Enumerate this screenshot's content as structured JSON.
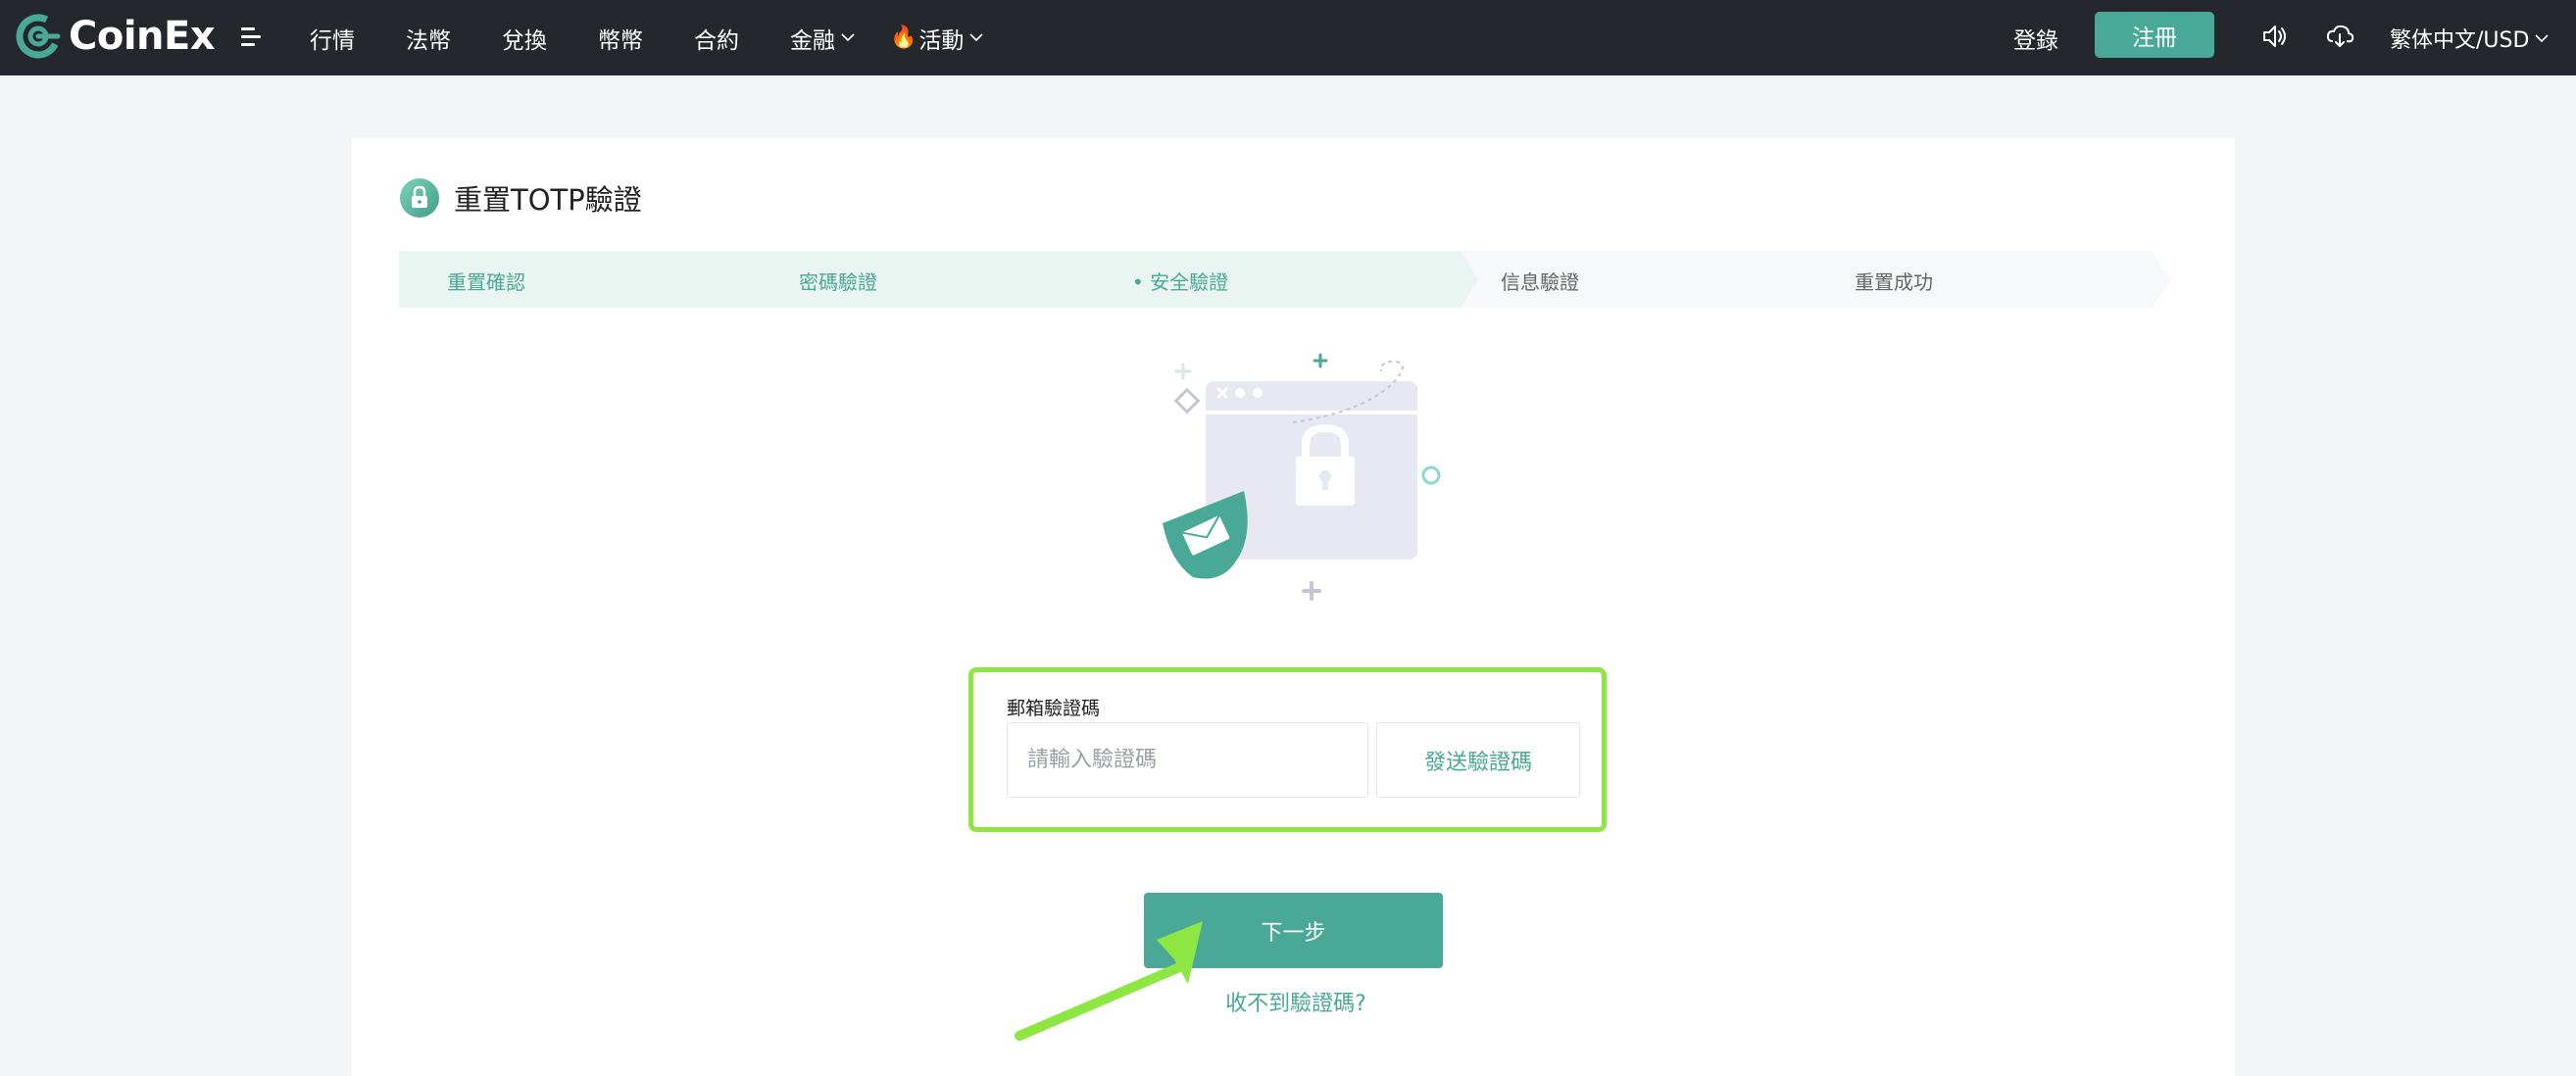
{
  "brand": {
    "name": "CoinEx",
    "accent": "#4aa996",
    "highlight": "#8ee643"
  },
  "nav": {
    "items": [
      {
        "label": "行情",
        "dropdown": false
      },
      {
        "label": "法幣",
        "dropdown": false
      },
      {
        "label": "兌換",
        "dropdown": false
      },
      {
        "label": "幣幣",
        "dropdown": false
      },
      {
        "label": "合約",
        "dropdown": false
      },
      {
        "label": "金融",
        "dropdown": true
      },
      {
        "label": "活動",
        "dropdown": true,
        "icon": "fire-icon"
      }
    ],
    "login": "登錄",
    "register": "注冊",
    "language": "繁体中文/USD"
  },
  "page": {
    "title": "重置TOTP驗證",
    "steps": [
      {
        "label": "重置確認",
        "state": "done"
      },
      {
        "label": "密碼驗證",
        "state": "done"
      },
      {
        "label": "安全驗證",
        "state": "active"
      },
      {
        "label": "信息驗證",
        "state": "pending"
      },
      {
        "label": "重置成功",
        "state": "pending"
      }
    ],
    "form": {
      "label": "郵箱驗證碼",
      "placeholder": "請輸入驗證碼",
      "value": "",
      "send_label": "發送驗證碼",
      "next_label": "下一步",
      "no_code_label": "收不到驗證碼?"
    }
  }
}
